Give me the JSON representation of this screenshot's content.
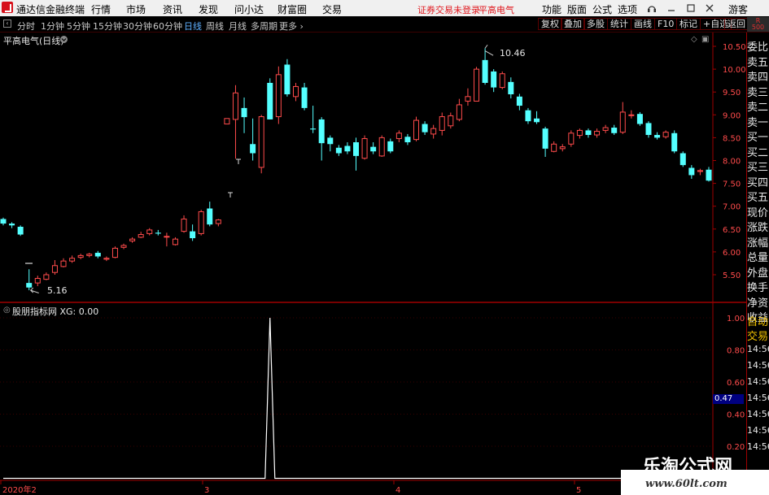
{
  "titlebar": {
    "app_name": "通达信金融终端",
    "menu": [
      "行情",
      "市场",
      "资讯",
      "发现",
      "问小达",
      "财富圈",
      "交易"
    ],
    "login_status": "证券交易未登录",
    "stock_name": "平高电气",
    "right_menu": [
      "功能",
      "版面",
      "公式",
      "选项"
    ],
    "user": "游客"
  },
  "periods": [
    "分时",
    "1分钟",
    "5分钟",
    "15分钟",
    "30分钟",
    "60分钟",
    "日线",
    "周线",
    "月线",
    "多周期",
    "更多"
  ],
  "active_period": "日线",
  "right_buttons": [
    "复权",
    "叠加",
    "多股",
    "统计",
    "画线",
    "F10",
    "标记",
    "+自选",
    "返回"
  ],
  "right_corner": {
    "top": "R",
    "bottom": "500"
  },
  "main_chart": {
    "title": "平高电气(日线)",
    "high_label": "10.46",
    "low_label": "5.16",
    "y_axis": [
      "10.50",
      "10.00",
      "9.50",
      "9.00",
      "8.50",
      "8.00",
      "7.50",
      "7.00",
      "6.50",
      "6.00",
      "5.50"
    ]
  },
  "indicator": {
    "title": "股朋指标网 XG: 0.00",
    "y_axis": [
      "1.00",
      "0.80",
      "0.60",
      "0.40",
      "0.20"
    ],
    "current_value": "0.47"
  },
  "x_axis": [
    "2020年2",
    "3",
    "4",
    "5"
  ],
  "sidebar": [
    "委比",
    "卖五",
    "卖四",
    "卖三",
    "卖二",
    "卖一",
    "买一",
    "买二",
    "买三",
    "买四",
    "买五",
    "现价",
    "涨跌",
    "涨幅",
    "总量",
    "外盘",
    "换手",
    "净资",
    "收益"
  ],
  "sidebar_extra": [
    "自动",
    "交易"
  ],
  "times": [
    "14:56",
    "14:56",
    "14:56",
    "14:56",
    "14:56",
    "14:56",
    "14:56"
  ],
  "watermark": {
    "title": "乐淘公式网",
    "url": "www.60lt.com"
  },
  "colors": {
    "up": "#ff4b4b",
    "down": "#54ffff",
    "frame": "#a00000",
    "grid": "#3a0000",
    "line": "#ffffff"
  },
  "chart_data": {
    "type": "candlestick",
    "title": "平高电气(日线)",
    "ylim": [
      5.1,
      10.8
    ],
    "candles": [
      {
        "o": 6.72,
        "c": 6.62,
        "h": 6.75,
        "l": 6.58
      },
      {
        "o": 6.62,
        "c": 6.58,
        "h": 6.65,
        "l": 6.52
      },
      {
        "o": 6.55,
        "c": 6.38,
        "h": 6.58,
        "l": 6.35
      },
      {
        "o": 5.32,
        "c": 5.22,
        "h": 5.62,
        "l": 5.16
      },
      {
        "o": 5.32,
        "c": 5.42,
        "h": 5.48,
        "l": 5.25
      },
      {
        "o": 5.4,
        "c": 5.5,
        "h": 5.55,
        "l": 5.38
      },
      {
        "o": 5.55,
        "c": 5.7,
        "h": 5.82,
        "l": 5.5
      },
      {
        "o": 5.68,
        "c": 5.8,
        "h": 5.86,
        "l": 5.66
      },
      {
        "o": 5.8,
        "c": 5.86,
        "h": 5.92,
        "l": 5.76
      },
      {
        "o": 5.88,
        "c": 5.92,
        "h": 5.96,
        "l": 5.84
      },
      {
        "o": 5.92,
        "c": 5.95,
        "h": 5.98,
        "l": 5.88
      },
      {
        "o": 5.98,
        "c": 5.9,
        "h": 6.02,
        "l": 5.86
      },
      {
        "o": 5.84,
        "c": 5.86,
        "h": 5.9,
        "l": 5.8
      },
      {
        "o": 5.88,
        "c": 6.08,
        "h": 6.12,
        "l": 5.86
      },
      {
        "o": 6.1,
        "c": 6.14,
        "h": 6.18,
        "l": 6.06
      },
      {
        "o": 6.24,
        "c": 6.28,
        "h": 6.32,
        "l": 6.2
      },
      {
        "o": 6.32,
        "c": 6.38,
        "h": 6.44,
        "l": 6.3
      },
      {
        "o": 6.4,
        "c": 6.48,
        "h": 6.52,
        "l": 6.36
      },
      {
        "o": 6.42,
        "c": 6.4,
        "h": 6.48,
        "l": 6.36
      },
      {
        "o": 6.34,
        "c": 6.34,
        "h": 6.42,
        "l": 6.12
      },
      {
        "o": 6.16,
        "c": 6.28,
        "h": 6.32,
        "l": 6.14
      },
      {
        "o": 6.45,
        "c": 6.72,
        "h": 6.8,
        "l": 6.42
      },
      {
        "o": 6.45,
        "c": 6.3,
        "h": 6.6,
        "l": 6.24
      },
      {
        "o": 6.4,
        "c": 6.88,
        "h": 6.92,
        "l": 6.36
      },
      {
        "o": 6.95,
        "c": 6.6,
        "h": 7.1,
        "l": 6.56
      },
      {
        "o": 6.62,
        "c": 6.7,
        "h": 6.72,
        "l": 6.56
      },
      {
        "o": 8.8,
        "c": 8.92,
        "h": 8.92,
        "l": 8.8
      },
      {
        "o": 8.9,
        "c": 9.48,
        "h": 9.65,
        "l": 8.04
      },
      {
        "o": 9.15,
        "c": 8.95,
        "h": 9.38,
        "l": 8.6
      },
      {
        "o": 8.36,
        "c": 8.16,
        "h": 8.92,
        "l": 8.0
      },
      {
        "o": 7.85,
        "c": 8.96,
        "h": 9.0,
        "l": 7.72
      },
      {
        "o": 9.7,
        "c": 8.9,
        "h": 9.8,
        "l": 8.9
      },
      {
        "o": 8.96,
        "c": 9.88,
        "h": 10.06,
        "l": 8.8
      },
      {
        "o": 10.1,
        "c": 9.45,
        "h": 10.22,
        "l": 9.4
      },
      {
        "o": 9.4,
        "c": 9.62,
        "h": 9.7,
        "l": 9.3
      },
      {
        "o": 9.6,
        "c": 9.15,
        "h": 9.7,
        "l": 9.1
      },
      {
        "o": 8.7,
        "c": 8.68,
        "h": 9.2,
        "l": 8.6
      },
      {
        "o": 8.9,
        "c": 8.38,
        "h": 8.95,
        "l": 8.0
      },
      {
        "o": 8.5,
        "c": 8.36,
        "h": 8.55,
        "l": 8.2
      },
      {
        "o": 8.28,
        "c": 8.16,
        "h": 8.34,
        "l": 8.1
      },
      {
        "o": 8.32,
        "c": 8.2,
        "h": 8.4,
        "l": 8.14
      },
      {
        "o": 8.4,
        "c": 8.1,
        "h": 8.5,
        "l": 7.78
      },
      {
        "o": 8.05,
        "c": 8.48,
        "h": 8.55,
        "l": 8.02
      },
      {
        "o": 8.3,
        "c": 8.2,
        "h": 8.4,
        "l": 8.14
      },
      {
        "o": 8.1,
        "c": 8.5,
        "h": 8.55,
        "l": 8.08
      },
      {
        "o": 8.42,
        "c": 8.2,
        "h": 8.48,
        "l": 8.16
      },
      {
        "o": 8.48,
        "c": 8.6,
        "h": 8.66,
        "l": 8.4
      },
      {
        "o": 8.52,
        "c": 8.4,
        "h": 8.58,
        "l": 8.34
      },
      {
        "o": 8.46,
        "c": 8.88,
        "h": 8.96,
        "l": 8.42
      },
      {
        "o": 8.8,
        "c": 8.62,
        "h": 8.86,
        "l": 8.56
      },
      {
        "o": 8.58,
        "c": 8.7,
        "h": 8.78,
        "l": 8.48
      },
      {
        "o": 8.66,
        "c": 8.96,
        "h": 9.05,
        "l": 8.55
      },
      {
        "o": 8.76,
        "c": 8.98,
        "h": 9.05,
        "l": 8.7
      },
      {
        "o": 8.9,
        "c": 9.22,
        "h": 9.35,
        "l": 8.86
      },
      {
        "o": 9.3,
        "c": 9.4,
        "h": 9.58,
        "l": 9.2
      },
      {
        "o": 9.3,
        "c": 10.0,
        "h": 10.05,
        "l": 9.3
      },
      {
        "o": 10.2,
        "c": 9.7,
        "h": 10.46,
        "l": 9.66
      },
      {
        "o": 9.95,
        "c": 9.6,
        "h": 10.0,
        "l": 9.5
      },
      {
        "o": 9.6,
        "c": 9.9,
        "h": 9.95,
        "l": 9.56
      },
      {
        "o": 9.72,
        "c": 9.45,
        "h": 9.82,
        "l": 9.36
      },
      {
        "o": 9.4,
        "c": 9.2,
        "h": 9.46,
        "l": 9.1
      },
      {
        "o": 9.1,
        "c": 8.86,
        "h": 9.15,
        "l": 8.8
      },
      {
        "o": 8.92,
        "c": 8.84,
        "h": 9.08,
        "l": 8.8
      },
      {
        "o": 8.7,
        "c": 8.26,
        "h": 8.74,
        "l": 8.08
      },
      {
        "o": 8.2,
        "c": 8.36,
        "h": 8.42,
        "l": 8.18
      },
      {
        "o": 8.26,
        "c": 8.3,
        "h": 8.36,
        "l": 8.2
      },
      {
        "o": 8.36,
        "c": 8.6,
        "h": 8.66,
        "l": 8.3
      },
      {
        "o": 8.55,
        "c": 8.66,
        "h": 8.7,
        "l": 8.48
      },
      {
        "o": 8.66,
        "c": 8.56,
        "h": 8.7,
        "l": 8.5
      },
      {
        "o": 8.56,
        "c": 8.64,
        "h": 8.7,
        "l": 8.5
      },
      {
        "o": 8.66,
        "c": 8.72,
        "h": 8.78,
        "l": 8.6
      },
      {
        "o": 8.72,
        "c": 8.6,
        "h": 8.78,
        "l": 8.56
      },
      {
        "o": 8.62,
        "c": 9.06,
        "h": 9.28,
        "l": 8.58
      },
      {
        "o": 9.0,
        "c": 9.0,
        "h": 9.1,
        "l": 8.92
      },
      {
        "o": 9.02,
        "c": 8.8,
        "h": 9.06,
        "l": 8.76
      },
      {
        "o": 8.82,
        "c": 8.56,
        "h": 8.86,
        "l": 8.5
      },
      {
        "o": 8.56,
        "c": 8.5,
        "h": 8.62,
        "l": 8.46
      },
      {
        "o": 8.52,
        "c": 8.62,
        "h": 8.66,
        "l": 8.48
      },
      {
        "o": 8.6,
        "c": 8.2,
        "h": 8.66,
        "l": 8.16
      },
      {
        "o": 8.16,
        "c": 7.9,
        "h": 8.2,
        "l": 7.86
      },
      {
        "o": 7.84,
        "c": 7.68,
        "h": 7.9,
        "l": 7.6
      },
      {
        "o": 7.76,
        "c": 7.78,
        "h": 7.82,
        "l": 7.68
      },
      {
        "o": 7.8,
        "c": 7.56,
        "h": 7.86,
        "l": 7.54
      }
    ],
    "signal_spike_index": 31,
    "signal_peak": 1.0,
    "ind_ylim": [
      0,
      1.09
    ]
  }
}
